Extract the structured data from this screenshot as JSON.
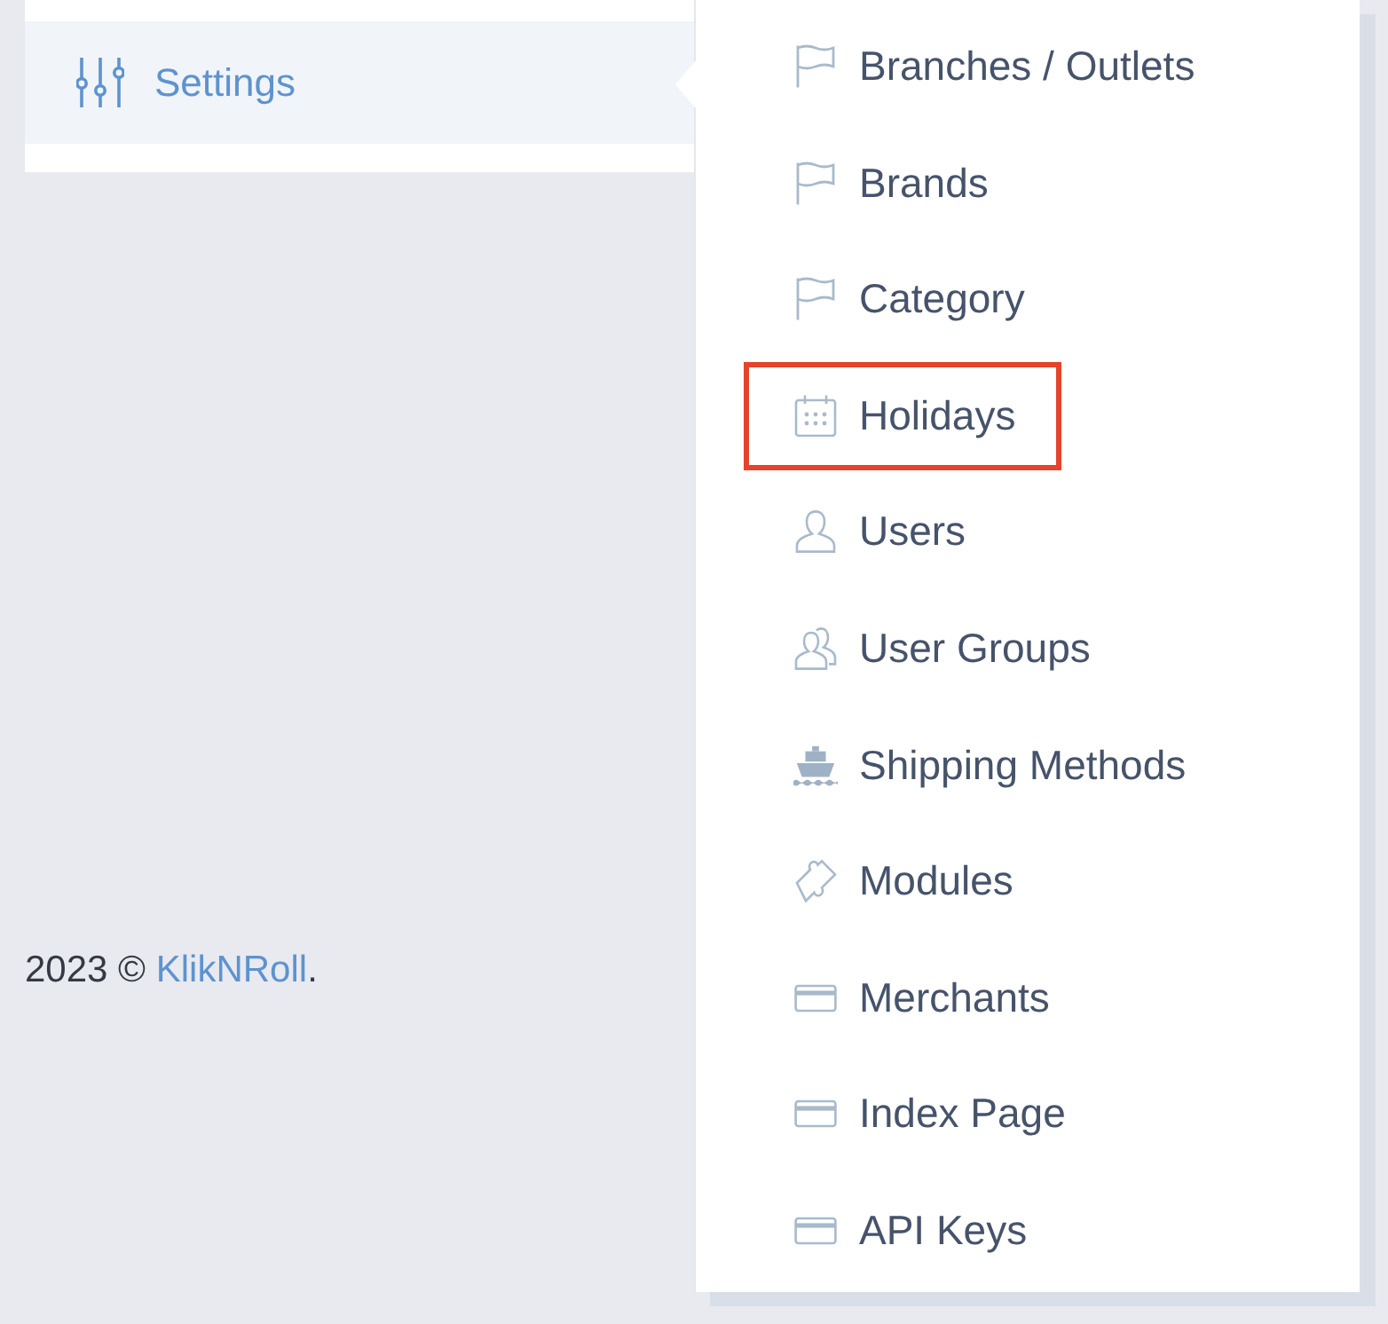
{
  "sidebar": {
    "items": [
      {
        "label": "Settings",
        "selected": true
      }
    ]
  },
  "submenu": {
    "items": [
      {
        "label": "Branches / Outlets",
        "kind": "flag",
        "highlighted": false
      },
      {
        "label": "Brands",
        "kind": "flag",
        "highlighted": false
      },
      {
        "label": "Category",
        "kind": "flag",
        "highlighted": false
      },
      {
        "label": "Holidays",
        "kind": "calendar",
        "highlighted": true
      },
      {
        "label": "Users",
        "kind": "user",
        "highlighted": false
      },
      {
        "label": "User Groups",
        "kind": "users",
        "highlighted": false
      },
      {
        "label": "Shipping Methods",
        "kind": "ship",
        "highlighted": false
      },
      {
        "label": "Modules",
        "kind": "puzzle",
        "highlighted": false
      },
      {
        "label": "Merchants",
        "kind": "card",
        "highlighted": false
      },
      {
        "label": "Index Page",
        "kind": "card",
        "highlighted": false
      },
      {
        "label": "API Keys",
        "kind": "card",
        "highlighted": false
      }
    ]
  },
  "footer": {
    "text": "2023 ©",
    "link": "KlikNRoll",
    "suffix": "."
  }
}
